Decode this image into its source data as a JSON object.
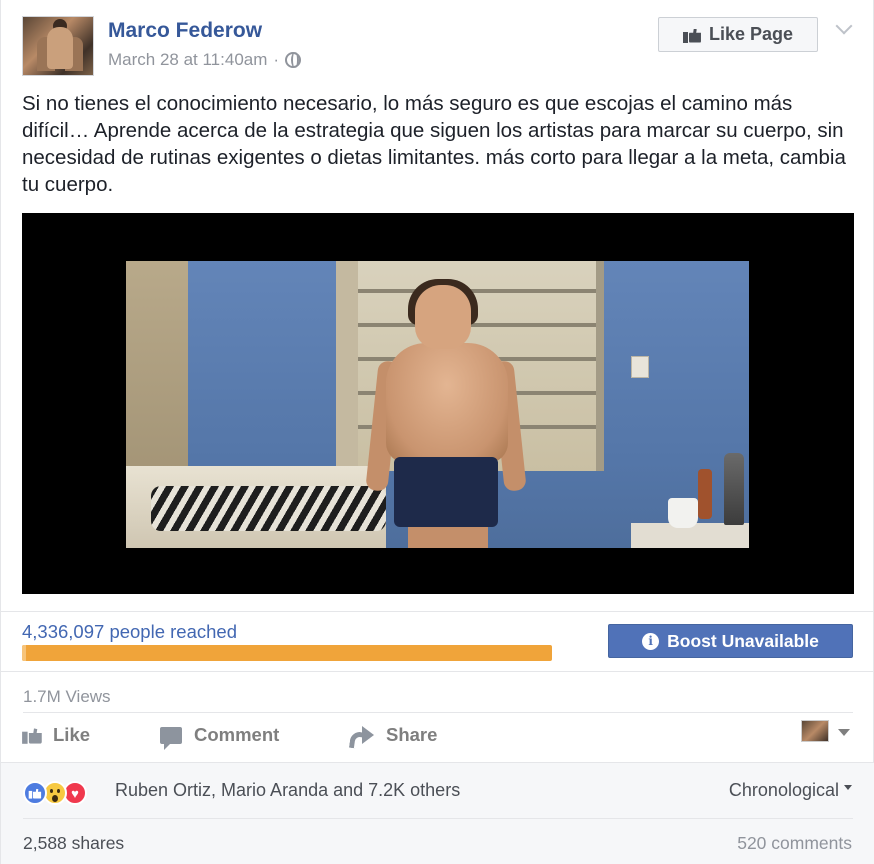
{
  "post": {
    "author": "Marco Federow",
    "timestamp": "March 28 at 11:40am",
    "separator": "·",
    "privacy_icon": "globe-icon",
    "like_page_label": "Like Page",
    "text": "Si no tienes el conocimiento necesario, lo más seguro es que escojas el camino más difícil… Aprende acerca de la estrategia que siguen los artistas para marcar su cuerpo, sin necesidad de rutinas exigentes o dietas limitantes. más corto para llegar a la meta, cambia tu cuerpo."
  },
  "insights": {
    "reach_text": "4,336,097 people reached",
    "reach_fraction": 1.0,
    "boost_label": "Boost Unavailable",
    "views": "1.7M Views"
  },
  "actions": {
    "like_label": "Like",
    "comment_label": "Comment",
    "share_label": "Share"
  },
  "summary": {
    "reaction_names": "Ruben Ortiz, Mario Aranda and 7.2K others",
    "sort_label": "Chronological",
    "shares": "2,588 shares",
    "comments": "520 comments"
  },
  "colors": {
    "link_blue": "#365899",
    "boost_blue": "#4267b2",
    "reach_bar": "#f0a43a"
  }
}
